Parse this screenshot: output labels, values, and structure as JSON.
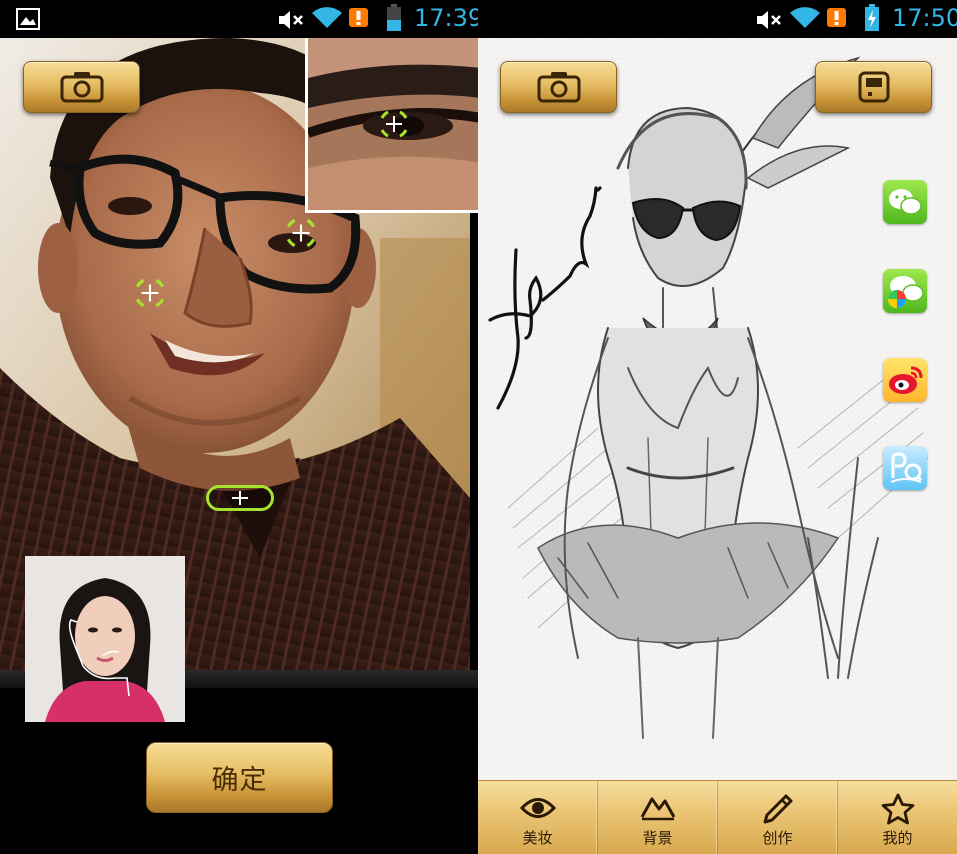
{
  "left_status": {
    "time": "17:39"
  },
  "right_status": {
    "time": "17:50"
  },
  "left_screen": {
    "confirm_label": "确定"
  },
  "right_screen": {
    "share_targets": [
      "wechat",
      "wechat-moments",
      "weibo",
      "qzone"
    ],
    "nav": [
      {
        "label": "美妆",
        "icon": "eye-icon"
      },
      {
        "label": "背景",
        "icon": "mountain-icon"
      },
      {
        "label": "创作",
        "icon": "pencil-icon"
      },
      {
        "label": "我的",
        "icon": "star-icon"
      }
    ]
  },
  "colors": {
    "status_blue": "#33b5e5",
    "gold_light": "#f6dd95",
    "gold_dark": "#a9782a",
    "marker_green": "#a6e22e"
  }
}
